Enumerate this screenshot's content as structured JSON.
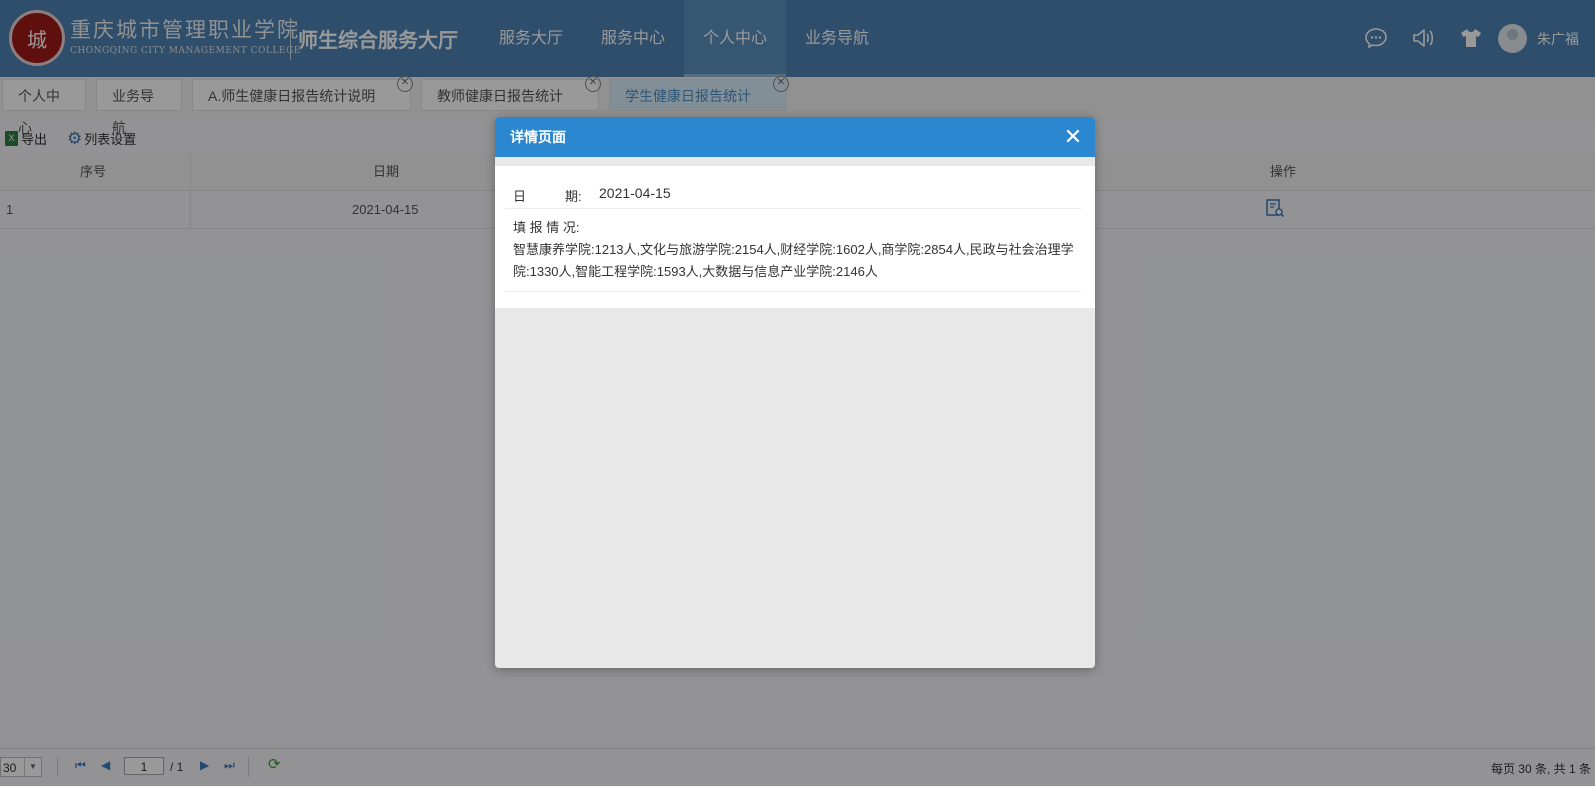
{
  "header": {
    "logo_char": "城",
    "college_name": "重庆城市管理职业学院",
    "college_en": "CHONGQING CITY MANAGEMENT COLLEGE",
    "portal_title": "师生综合服务大厅",
    "nav": [
      "服务大厅",
      "服务中心",
      "个人中心",
      "业务导航"
    ],
    "active_nav": "个人中心",
    "username": "朱广福"
  },
  "tabs": [
    {
      "label": "个人中心",
      "closable": false
    },
    {
      "label": "业务导航",
      "closable": false
    },
    {
      "label": "A.师生健康日报告统计说明",
      "closable": true
    },
    {
      "label": "教师健康日报告统计",
      "closable": true
    },
    {
      "label": "学生健康日报告统计",
      "closable": true,
      "active": true
    }
  ],
  "toolbar": {
    "export_label": "导出",
    "xls_icon": "X",
    "settings_label": "列表设置"
  },
  "table": {
    "headers": {
      "seq": "序号",
      "date": "日期",
      "action": "操作"
    },
    "rows": [
      {
        "seq": "1",
        "date": "2021-04-15"
      }
    ]
  },
  "pager": {
    "page_size": "30",
    "current_page": "1",
    "total_pages": "/ 1",
    "info": "每页 30 条, 共 1 条"
  },
  "modal": {
    "title": "详情页面",
    "close_glyph": "✕",
    "date_label": "日　　　期:",
    "date_value": "2021-04-15",
    "report_label": "填 报 情 况:",
    "report_value": "智慧康养学院:1213人,文化与旅游学院:2154人,财经学院:1602人,商学院:2854人,民政与社会治理学院:1330人,智能工程学院:1593人,大数据与信息产业学院:2146人"
  },
  "colors": {
    "header_bg": "#4d83b3",
    "modal_head": "#2b87d0",
    "active_tab": "#dbeefb"
  }
}
